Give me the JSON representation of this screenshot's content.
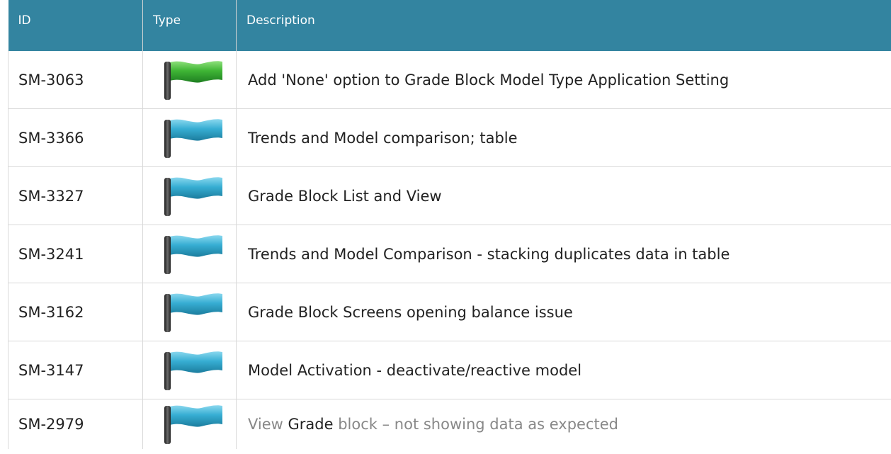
{
  "table": {
    "headers": {
      "id": "ID",
      "type": "Type",
      "description": "Description"
    },
    "rows": [
      {
        "id": "SM-3063",
        "type_icon": "green-flag-icon",
        "description": "Add 'None' option to Grade Block Model Type Application Setting"
      },
      {
        "id": "SM-3366",
        "type_icon": "blue-flag-icon",
        "description": "Trends and Model comparison; table"
      },
      {
        "id": "SM-3327",
        "type_icon": "blue-flag-icon",
        "description": "Grade Block List and View"
      },
      {
        "id": "SM-3241",
        "type_icon": "blue-flag-icon",
        "description": "Trends and Model Comparison - stacking duplicates data in table"
      },
      {
        "id": "SM-3162",
        "type_icon": "blue-flag-icon",
        "description": "Grade Block Screens opening balance issue"
      },
      {
        "id": "SM-3147",
        "type_icon": "blue-flag-icon",
        "description": "Model Activation - deactivate/reactive model"
      },
      {
        "id": "SM-2979",
        "type_icon": "blue-flag-icon",
        "description_parts": [
          "View ",
          "Grade",
          " block – not showing data as expected"
        ]
      }
    ]
  },
  "colors": {
    "header_bg": "#3384a0",
    "green_flag": "#3fb535",
    "blue_flag": "#37aed3"
  }
}
